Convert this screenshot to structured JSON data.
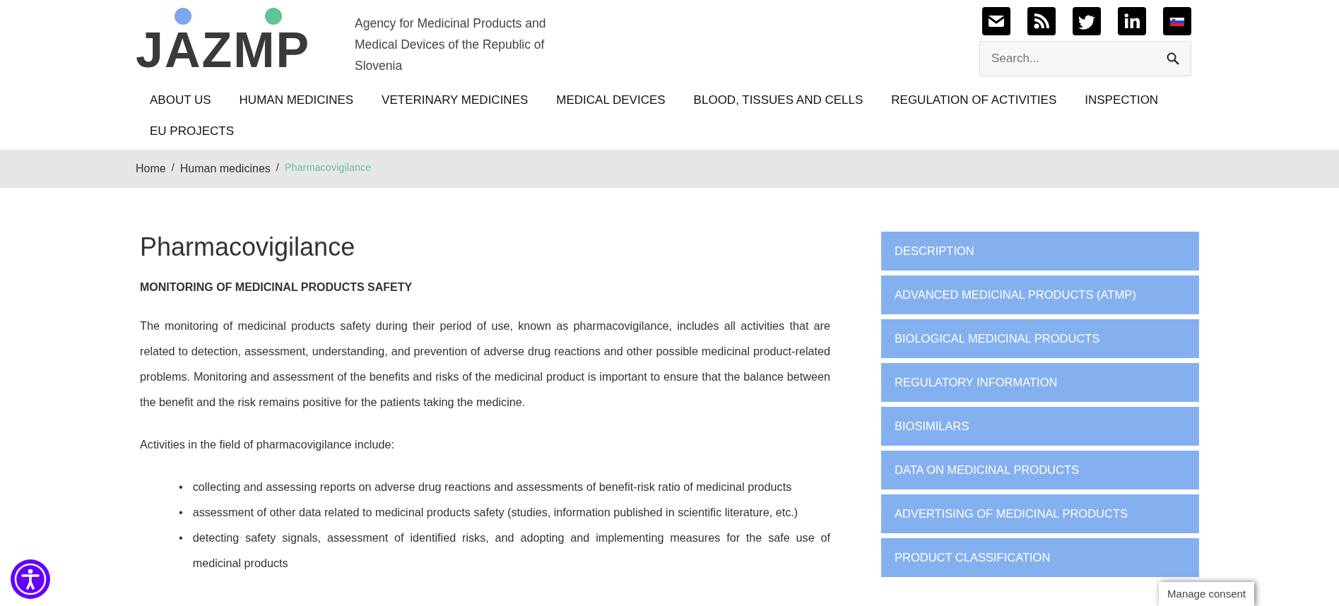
{
  "header": {
    "logo_text": "JAZMP",
    "tagline": "Agency for Medicinal Products and Medical Devices of the Republic of Slovenia",
    "social": [
      {
        "kind": "mail"
      },
      {
        "kind": "rss"
      },
      {
        "kind": "twitter"
      },
      {
        "kind": "linkedin"
      },
      {
        "kind": "flag"
      }
    ],
    "search": {
      "placeholder": "Search..."
    }
  },
  "nav": [
    "ABOUT US",
    "HUMAN MEDICINES",
    "VETERINARY MEDICINES",
    "MEDICAL DEVICES",
    "BLOOD, TISSUES AND CELLS",
    "REGULATION OF ACTIVITIES",
    "INSPECTION",
    "EU PROJECTS"
  ],
  "breadcrumb": [
    {
      "label": "Home",
      "current": false
    },
    {
      "label": "Human medicines",
      "current": false
    },
    {
      "label": "Pharmacovigilance",
      "current": true
    }
  ],
  "breadcrumb_separator": "/",
  "article": {
    "title": "Pharmacovigilance",
    "subtitle": "MONITORING OF MEDICINAL PRODUCTS SAFETY",
    "paragraphs": [
      "The monitoring of medicinal products safety during their period of use, known as pharmacovigilance, includes all activities that are related to detection, assessment, understanding, and prevention of adverse drug reactions and other possible medicinal product-related problems. Monitoring and assessment of the benefits and risks of the medicinal product is important to ensure that the balance between the benefit and the risk remains positive for the patients taking the medicine.",
      "Activities in the field of pharmacovigilance include:"
    ],
    "bullet_marker": "•",
    "bullets": [
      "collecting and assessing reports on adverse drug reactions and assessments of benefit-risk ratio of medicinal products",
      "assessment of other data related to medicinal products safety (studies, information published in scientific literature, etc.)",
      "detecting safety signals, assessment of identified risks, and adopting and implementing measures for the safe use of medicinal products"
    ]
  },
  "sidebar": [
    "DESCRIPTION",
    "ADVANCED MEDICINAL PRODUCTS (ATMP)",
    "BIOLOGICAL MEDICINAL PRODUCTS",
    "REGULATORY INFORMATION",
    "BIOSIMILARS",
    "DATA ON MEDICINAL PRODUCTS",
    "ADVERTISING OF MEDICINAL PRODUCTS",
    "PRODUCT CLASSIFICATION"
  ],
  "consent_button": "Manage consent"
}
